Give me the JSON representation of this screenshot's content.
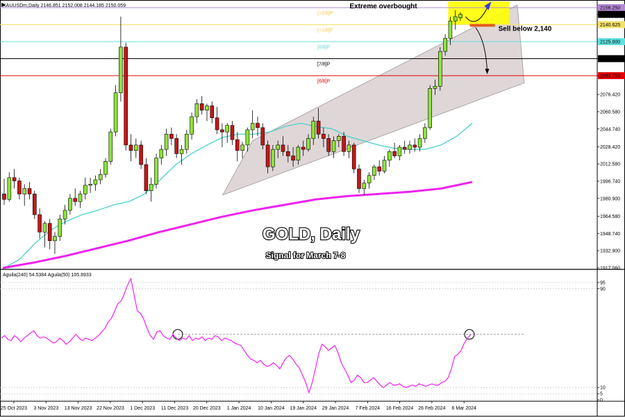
{
  "chart_data": [
    {
      "type": "candlestick",
      "header": "XAUUSDm,Daily  2146.851 2152.008 2144.185 2150.059",
      "title": "GOLD, Daily",
      "subtitle": "Signal for March 7-8",
      "annotations": {
        "top": "Extreme overbought",
        "sell": "Sell below 2,140"
      },
      "ylim": [
        1917.0,
        2162.0
      ],
      "y_ticks": [
        "2150.059",
        "2140.625",
        "2125.000",
        "2109.375",
        "2093.750",
        "2076.420",
        "2060.580",
        "2044.740",
        "2028.420",
        "2012.580",
        "1996.740",
        "1980.900",
        "1964.580",
        "1948.740",
        "1932.900",
        "1917.060"
      ],
      "y_tick_values": [
        2150.059,
        2140.625,
        2125.0,
        2109.375,
        2093.75,
        2076.42,
        2060.58,
        2044.74,
        2028.42,
        2012.58,
        1996.74,
        1980.9,
        1964.58,
        1948.74,
        1932.9,
        1917.06
      ],
      "price_tags": [
        {
          "label": "2156.250",
          "value": 2156.25,
          "color": "#b388d4"
        },
        {
          "label": "2150.059",
          "value": 2150.059,
          "color": "#000000"
        },
        {
          "label": "2140.625",
          "value": 2140.625,
          "color": "#f2e06a"
        },
        {
          "label": "2125.000",
          "value": 2125.0,
          "color": "#5fe0e0"
        },
        {
          "label": "2109.375",
          "value": 2109.375,
          "color": "#000000"
        },
        {
          "label": "2093.750",
          "value": 2093.75,
          "color": "#e00000"
        }
      ],
      "murrey_lines": [
        {
          "label": "[+2/8]P",
          "value": 2156.25,
          "color": "#b388d4",
          "text_color": "#f2c94c"
        },
        {
          "label": "[+1/8]P",
          "value": 2140.625,
          "color": "#f2e06a",
          "text_color": "#f2c94c"
        },
        {
          "label": "[8/8]P",
          "value": 2125.0,
          "color": "#5fe0e0",
          "text_color": "#5fe0e0"
        },
        {
          "label": "[7/8]P",
          "value": 2109.375,
          "color": "#000000",
          "text_color": "#000000"
        },
        {
          "label": "[6/8]P",
          "value": 2093.75,
          "color": "#e00000",
          "text_color": "#e00000"
        }
      ],
      "x_labels": [
        "25 Oct 2023",
        "3 Nov 2023",
        "13 Nov 2023",
        "22 Nov 2023",
        "1 Dec 2023",
        "11 Dec 2023",
        "20 Dec 2023",
        "1 Jan 2024",
        "10 Jan 2024",
        "19 Jan 2024",
        "29 Jan 2024",
        "7 Feb 2024",
        "16 Feb 2024",
        "26 Feb 2024",
        "6 Mar 2024"
      ],
      "candles": [
        {
          "o": 1985.0,
          "h": 1999.0,
          "l": 1975.0,
          "c": 1980.0
        },
        {
          "o": 1980.0,
          "h": 2005.0,
          "l": 1978.0,
          "c": 2000.0
        },
        {
          "o": 2000.0,
          "h": 2008.0,
          "l": 1990.0,
          "c": 1997.0
        },
        {
          "o": 1997.0,
          "h": 2000.0,
          "l": 1980.0,
          "c": 1985.0
        },
        {
          "o": 1985.0,
          "h": 1994.0,
          "l": 1974.0,
          "c": 1990.0
        },
        {
          "o": 1990.0,
          "h": 1996.0,
          "l": 1980.0,
          "c": 1985.0
        },
        {
          "o": 1985.0,
          "h": 1988.0,
          "l": 1962.0,
          "c": 1966.0
        },
        {
          "o": 1966.0,
          "h": 1972.0,
          "l": 1944.0,
          "c": 1950.0
        },
        {
          "o": 1950.0,
          "h": 1960.0,
          "l": 1936.0,
          "c": 1958.0
        },
        {
          "o": 1958.0,
          "h": 1962.0,
          "l": 1934.0,
          "c": 1942.0
        },
        {
          "o": 1942.0,
          "h": 1950.0,
          "l": 1930.0,
          "c": 1946.0
        },
        {
          "o": 1946.0,
          "h": 1966.0,
          "l": 1942.0,
          "c": 1962.0
        },
        {
          "o": 1962.0,
          "h": 1975.0,
          "l": 1957.0,
          "c": 1970.0
        },
        {
          "o": 1970.0,
          "h": 1985.0,
          "l": 1966.0,
          "c": 1981.0
        },
        {
          "o": 1981.0,
          "h": 1990.0,
          "l": 1974.0,
          "c": 1978.0
        },
        {
          "o": 1978.0,
          "h": 1988.0,
          "l": 1972.0,
          "c": 1985.0
        },
        {
          "o": 1985.0,
          "h": 2000.0,
          "l": 1980.0,
          "c": 1993.0
        },
        {
          "o": 1993.0,
          "h": 2000.0,
          "l": 1986.0,
          "c": 1994.0
        },
        {
          "o": 1994.0,
          "h": 2002.0,
          "l": 1988.0,
          "c": 1998.0
        },
        {
          "o": 1998.0,
          "h": 2008.0,
          "l": 1994.0,
          "c": 2003.0
        },
        {
          "o": 2003.0,
          "h": 2018.0,
          "l": 2000.0,
          "c": 2015.0
        },
        {
          "o": 2015.0,
          "h": 2045.0,
          "l": 2012.0,
          "c": 2042.0
        },
        {
          "o": 2042.0,
          "h": 2085.0,
          "l": 2038.0,
          "c": 2078.0
        },
        {
          "o": 2078.0,
          "h": 2148.0,
          "l": 2070.0,
          "c": 2120.0
        },
        {
          "o": 2120.0,
          "h": 2124.0,
          "l": 2025.0,
          "c": 2030.0
        },
        {
          "o": 2030.0,
          "h": 2040.0,
          "l": 2015.0,
          "c": 2025.0
        },
        {
          "o": 2025.0,
          "h": 2036.0,
          "l": 2018.0,
          "c": 2030.0
        },
        {
          "o": 2030.0,
          "h": 2034.0,
          "l": 2008.0,
          "c": 2012.0
        },
        {
          "o": 2012.0,
          "h": 2018.0,
          "l": 1985.0,
          "c": 1988.0
        },
        {
          "o": 1988.0,
          "h": 2000.0,
          "l": 1978.0,
          "c": 1994.0
        },
        {
          "o": 1994.0,
          "h": 2022.0,
          "l": 1990.0,
          "c": 2018.0
        },
        {
          "o": 2018.0,
          "h": 2030.0,
          "l": 2012.0,
          "c": 2026.0
        },
        {
          "o": 2026.0,
          "h": 2045.0,
          "l": 2020.0,
          "c": 2040.0
        },
        {
          "o": 2040.0,
          "h": 2046.0,
          "l": 2030.0,
          "c": 2036.0
        },
        {
          "o": 2036.0,
          "h": 2040.0,
          "l": 2018.0,
          "c": 2022.0
        },
        {
          "o": 2022.0,
          "h": 2030.0,
          "l": 2012.0,
          "c": 2026.0
        },
        {
          "o": 2026.0,
          "h": 2044.0,
          "l": 2022.0,
          "c": 2040.0
        },
        {
          "o": 2040.0,
          "h": 2060.0,
          "l": 2035.0,
          "c": 2056.0
        },
        {
          "o": 2056.0,
          "h": 2072.0,
          "l": 2050.0,
          "c": 2068.0
        },
        {
          "o": 2068.0,
          "h": 2075.0,
          "l": 2058.0,
          "c": 2062.0
        },
        {
          "o": 2062.0,
          "h": 2068.0,
          "l": 2052.0,
          "c": 2066.0
        },
        {
          "o": 2066.0,
          "h": 2070.0,
          "l": 2050.0,
          "c": 2055.0
        },
        {
          "o": 2055.0,
          "h": 2065.0,
          "l": 2040.0,
          "c": 2044.0
        },
        {
          "o": 2044.0,
          "h": 2050.0,
          "l": 2028.0,
          "c": 2042.0
        },
        {
          "o": 2042.0,
          "h": 2050.0,
          "l": 2032.0,
          "c": 2048.0
        },
        {
          "o": 2048.0,
          "h": 2052.0,
          "l": 2030.0,
          "c": 2035.0
        },
        {
          "o": 2035.0,
          "h": 2042.0,
          "l": 2015.0,
          "c": 2025.0
        },
        {
          "o": 2025.0,
          "h": 2033.0,
          "l": 2018.0,
          "c": 2030.0
        },
        {
          "o": 2030.0,
          "h": 2046.0,
          "l": 2024.0,
          "c": 2044.0
        },
        {
          "o": 2044.0,
          "h": 2062.0,
          "l": 2036.0,
          "c": 2050.0
        },
        {
          "o": 2050.0,
          "h": 2056.0,
          "l": 2038.0,
          "c": 2046.0
        },
        {
          "o": 2046.0,
          "h": 2050.0,
          "l": 2026.0,
          "c": 2030.0
        },
        {
          "o": 2030.0,
          "h": 2034.0,
          "l": 2004.0,
          "c": 2010.0
        },
        {
          "o": 2010.0,
          "h": 2030.0,
          "l": 2006.0,
          "c": 2026.0
        },
        {
          "o": 2026.0,
          "h": 2034.0,
          "l": 2018.0,
          "c": 2030.0
        },
        {
          "o": 2030.0,
          "h": 2038.0,
          "l": 2020.0,
          "c": 2024.0
        },
        {
          "o": 2024.0,
          "h": 2030.0,
          "l": 2014.0,
          "c": 2020.0
        },
        {
          "o": 2020.0,
          "h": 2028.0,
          "l": 2010.0,
          "c": 2016.0
        },
        {
          "o": 2016.0,
          "h": 2030.0,
          "l": 2012.0,
          "c": 2028.0
        },
        {
          "o": 2028.0,
          "h": 2034.0,
          "l": 2020.0,
          "c": 2026.0
        },
        {
          "o": 2026.0,
          "h": 2040.0,
          "l": 2024.0,
          "c": 2036.0
        },
        {
          "o": 2036.0,
          "h": 2056.0,
          "l": 2030.0,
          "c": 2052.0
        },
        {
          "o": 2052.0,
          "h": 2064.0,
          "l": 2036.0,
          "c": 2040.0
        },
        {
          "o": 2040.0,
          "h": 2046.0,
          "l": 2028.0,
          "c": 2036.0
        },
        {
          "o": 2036.0,
          "h": 2040.0,
          "l": 2020.0,
          "c": 2024.0
        },
        {
          "o": 2024.0,
          "h": 2038.0,
          "l": 2018.0,
          "c": 2034.0
        },
        {
          "o": 2034.0,
          "h": 2040.0,
          "l": 2028.0,
          "c": 2038.0
        },
        {
          "o": 2038.0,
          "h": 2042.0,
          "l": 2020.0,
          "c": 2024.0
        },
        {
          "o": 2024.0,
          "h": 2034.0,
          "l": 2018.0,
          "c": 2030.0
        },
        {
          "o": 2030.0,
          "h": 2032.0,
          "l": 2004.0,
          "c": 2008.0
        },
        {
          "o": 2008.0,
          "h": 2012.0,
          "l": 1986.0,
          "c": 1990.0
        },
        {
          "o": 1990.0,
          "h": 1998.0,
          "l": 1984.0,
          "c": 1995.0
        },
        {
          "o": 1995.0,
          "h": 2005.0,
          "l": 1990.0,
          "c": 2002.0
        },
        {
          "o": 2002.0,
          "h": 2012.0,
          "l": 1998.0,
          "c": 2010.0
        },
        {
          "o": 2010.0,
          "h": 2016.0,
          "l": 2002.0,
          "c": 2006.0
        },
        {
          "o": 2006.0,
          "h": 2020.0,
          "l": 2004.0,
          "c": 2016.0
        },
        {
          "o": 2016.0,
          "h": 2026.0,
          "l": 2010.0,
          "c": 2024.0
        },
        {
          "o": 2024.0,
          "h": 2032.0,
          "l": 2018.0,
          "c": 2020.0
        },
        {
          "o": 2020.0,
          "h": 2030.0,
          "l": 2016.0,
          "c": 2028.0
        },
        {
          "o": 2028.0,
          "h": 2034.0,
          "l": 2022.0,
          "c": 2026.0
        },
        {
          "o": 2026.0,
          "h": 2034.0,
          "l": 2022.0,
          "c": 2030.0
        },
        {
          "o": 2030.0,
          "h": 2036.0,
          "l": 2024.0,
          "c": 2028.0
        },
        {
          "o": 2028.0,
          "h": 2040.0,
          "l": 2024.0,
          "c": 2036.0
        },
        {
          "o": 2036.0,
          "h": 2050.0,
          "l": 2032.0,
          "c": 2046.0
        },
        {
          "o": 2046.0,
          "h": 2085.0,
          "l": 2044.0,
          "c": 2082.0
        },
        {
          "o": 2082.0,
          "h": 2090.0,
          "l": 2076.0,
          "c": 2084.0
        },
        {
          "o": 2084.0,
          "h": 2120.0,
          "l": 2080.0,
          "c": 2116.0
        },
        {
          "o": 2116.0,
          "h": 2132.0,
          "l": 2112.0,
          "c": 2128.0
        },
        {
          "o": 2128.0,
          "h": 2148.0,
          "l": 2122.0,
          "c": 2144.0
        },
        {
          "o": 2144.0,
          "h": 2154.0,
          "l": 2136.0,
          "c": 2148.0
        },
        {
          "o": 2146.851,
          "h": 2152.008,
          "l": 2144.185,
          "c": 2150.059
        }
      ],
      "ma_fast": [
        1917.0,
        1925.0,
        1940.0,
        1952.0,
        1960.0,
        1966.0,
        1970.0,
        1975.0,
        1978.0,
        1985.0,
        1998.0,
        2012.0,
        2022.0,
        2030.0,
        2037.0,
        2040.0,
        2040.0,
        2042.0,
        2047.0,
        2050.0,
        2047.0,
        2045.0,
        2038.0,
        2034.0,
        2030.0,
        2027.0,
        2026.0,
        2026.0,
        2030.0,
        2038.0,
        2050.0
      ],
      "ma_slow": [
        1917.0,
        1922.0,
        1928.0,
        1935.0,
        1942.0,
        1950.0,
        1957.0,
        1964.0,
        1970.0,
        1975.0,
        1980.0,
        1983.0,
        1985.0,
        1987.0,
        1990.0,
        1996.0
      ],
      "channel": {
        "lower": [
          {
            "bar": 52,
            "value": 1984.0
          },
          {
            "bar": 93,
            "value": 2096.0
          }
        ],
        "upper": [
          {
            "bar": 49,
            "value": 2034.0
          },
          {
            "bar": 93,
            "value": 2160.0
          }
        ]
      },
      "overbought_zone": {
        "from_value": 2141.0,
        "to_value": 2162.0,
        "color": "#ffff00"
      },
      "sell_bar": {
        "value": 2140.0,
        "color": "#e45a1a"
      }
    },
    {
      "type": "line",
      "legend": "Aguila(240) 54.5384  Aguila(50) 105.8933",
      "series_color": "#ee22ee",
      "ylim": [
        0,
        100
      ],
      "y_ticks": [
        "95",
        "90",
        "10",
        "5",
        "0"
      ],
      "y_tick_values": [
        95,
        90,
        10,
        5,
        0
      ],
      "reference_level": 53,
      "values": [
        50,
        52,
        49,
        48,
        52,
        50,
        47,
        50,
        52,
        54,
        56,
        52,
        50,
        51,
        50,
        48,
        46,
        47,
        50,
        48,
        45,
        47,
        50,
        53,
        50,
        48,
        50,
        49,
        48,
        50,
        52,
        55,
        58,
        63,
        66,
        72,
        78,
        80,
        86,
        93,
        98,
        85,
        72,
        70,
        65,
        58,
        52,
        49,
        55,
        56,
        52,
        50,
        49,
        53,
        50,
        48,
        50,
        49,
        52,
        48,
        50,
        49,
        51,
        48,
        50,
        49,
        52,
        51,
        48,
        50,
        49,
        48,
        46,
        45,
        44,
        40,
        36,
        33,
        32,
        30,
        32,
        29,
        27,
        28,
        30,
        28,
        25,
        30,
        34,
        36,
        33,
        29,
        26,
        20,
        14,
        6,
        14,
        25,
        37,
        45,
        43,
        40,
        42,
        44,
        38,
        30,
        25,
        20,
        14,
        16,
        20,
        18,
        14,
        14,
        16,
        18,
        15,
        12,
        10,
        12,
        14,
        12,
        12,
        13,
        11,
        10,
        11,
        12,
        11,
        13,
        12,
        11,
        12,
        13,
        12,
        12,
        14,
        15,
        18,
        25,
        35,
        37,
        40,
        46,
        50,
        53
      ]
    }
  ]
}
